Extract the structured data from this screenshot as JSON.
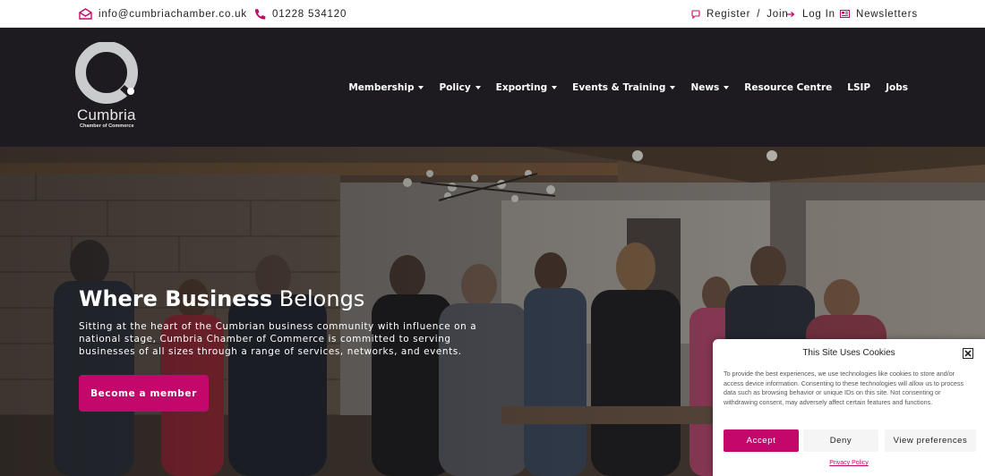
{
  "topbar": {
    "email": "info@cumbriachamber.co.uk",
    "phone": "01228 534120",
    "register": "Register",
    "separator": "/",
    "join": "Join",
    "login": "Log In",
    "newsletters": "Newsletters",
    "icons": [
      "envelope-icon",
      "phone-icon",
      "chat-icon",
      "arrow-right-icon",
      "newsletter-icon"
    ]
  },
  "header": {
    "logo_word": "Cumbria",
    "logo_sub": "Chamber of Commerce",
    "nav": [
      {
        "label": "Membership",
        "dropdown": true
      },
      {
        "label": "Policy",
        "dropdown": true
      },
      {
        "label": "Exporting",
        "dropdown": true
      },
      {
        "label": "Events & Training",
        "dropdown": true
      },
      {
        "label": "News",
        "dropdown": true
      },
      {
        "label": "Resource Centre",
        "dropdown": false
      },
      {
        "label": "LSIP",
        "dropdown": false
      },
      {
        "label": "Jobs",
        "dropdown": false
      }
    ]
  },
  "hero": {
    "title_bold": "Where Business",
    "title_light": "Belongs",
    "text": "Sitting at the heart of the Cumbrian business community with influence on a national stage, Cumbria Chamber of Commerce is committed to serving businesses of all sizes through a range of services, networks, and events.",
    "button": "Become a member"
  },
  "cookie": {
    "title": "This Site Uses Cookies",
    "text": "To provide the best experiences, we use technologies like cookies to store and/or access device information. Consenting to these technologies will allow us to process data such as browsing behavior or unique IDs on this site. Not consenting or withdrawing consent, may adversely affect certain features and functions.",
    "accept": "Accept",
    "deny": "Deny",
    "preferences": "View preferences",
    "policy": "Privacy Policy"
  },
  "colors": {
    "brand": "#c4086b",
    "header_bg": "#1d1b1f",
    "topbar_bg": "#ffffff"
  }
}
